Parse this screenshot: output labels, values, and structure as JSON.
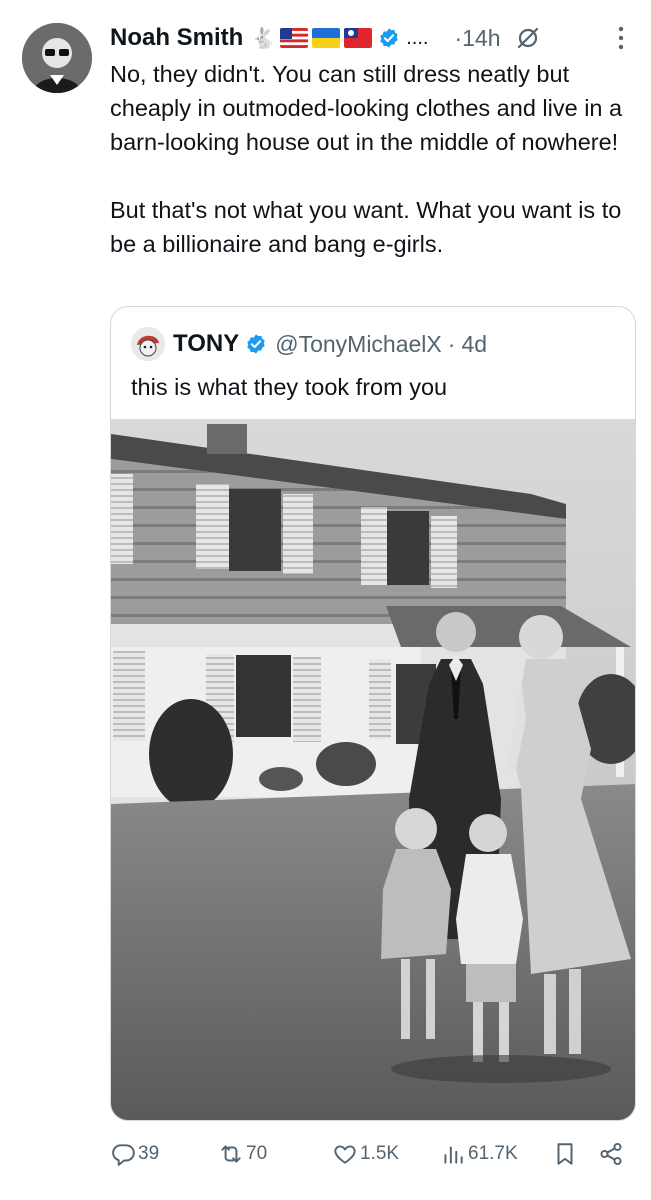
{
  "author": {
    "name": "Noah Smith",
    "badge_emoji": "🐇",
    "flags": [
      "us-flag-icon",
      "ukraine-flag-icon",
      "taiwan-flag-icon"
    ],
    "ellipsis": "....",
    "time": "·14h"
  },
  "tweet": {
    "text": "No, they didn't. You can still dress neatly but cheaply in outmoded-looking clothes and live in a barn-looking house out in the middle of nowhere!\n\nBut that's not what you want. What you want is to be a billionaire and bang e-girls."
  },
  "quoted": {
    "name": "TONY",
    "handle": "@TonyMichaelX",
    "separator": "·",
    "time": "4d",
    "text": "this is what they took from you"
  },
  "actions": {
    "replies": "39",
    "reposts": "70",
    "likes": "1.5K",
    "views": "61.7K"
  },
  "colors": {
    "text": "#0f1419",
    "secondary": "#536471",
    "verified": "#1d9bf0",
    "border": "#cfd9de"
  }
}
